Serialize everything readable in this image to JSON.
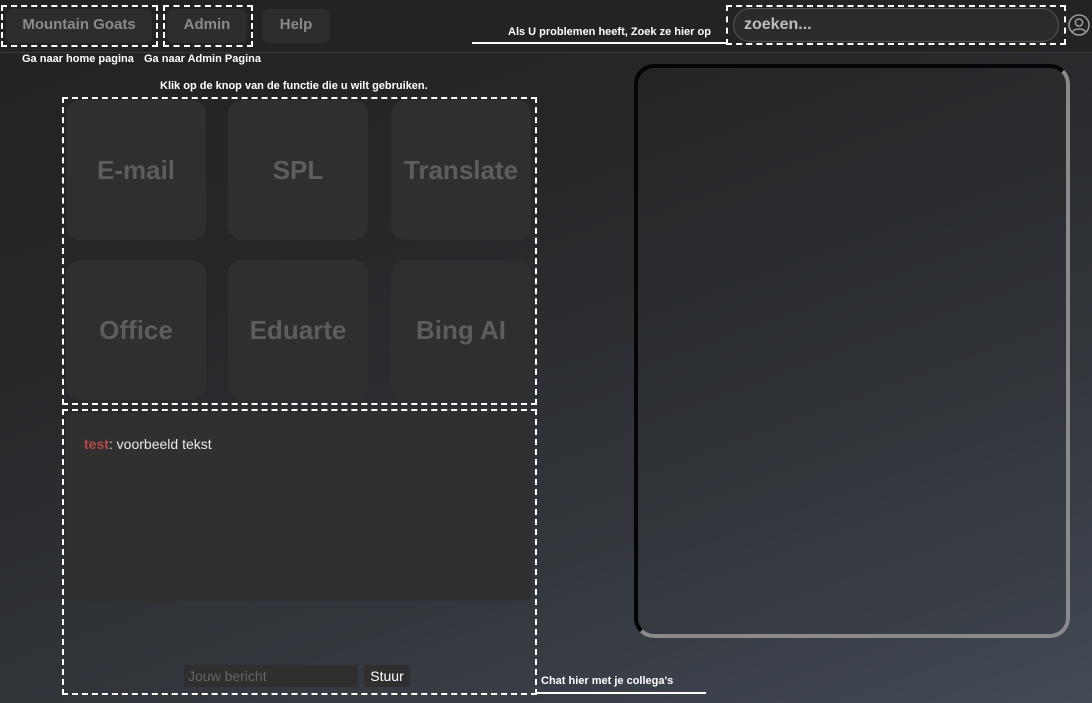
{
  "nav": {
    "home_label": "Mountain Goats",
    "admin_label": "Admin",
    "help_label": "Help"
  },
  "annotations": {
    "home": "Ga naar home pagina",
    "admin": "Ga naar Admin Pagina",
    "search": "Als U problemen heeft, Zoek ze hier op",
    "tiles": "Klik op de knop van de functie die u wilt gebruiken.",
    "chat": "Chat hier met je collega's"
  },
  "search": {
    "placeholder": "zoeken..."
  },
  "tiles": [
    "E-mail",
    "SPL",
    "Translate",
    "Office",
    "Eduarte",
    "Bing AI"
  ],
  "chat": {
    "messages": [
      {
        "user": "test",
        "text": ": voorbeeld tekst"
      }
    ],
    "input_placeholder": "Jouw bericht",
    "send_label": "Stuur"
  },
  "colors": {
    "username": "#b54848",
    "annotation": "#ffffff",
    "tile_text": "#5d5d5d"
  },
  "icons": {
    "user": "user-icon"
  }
}
